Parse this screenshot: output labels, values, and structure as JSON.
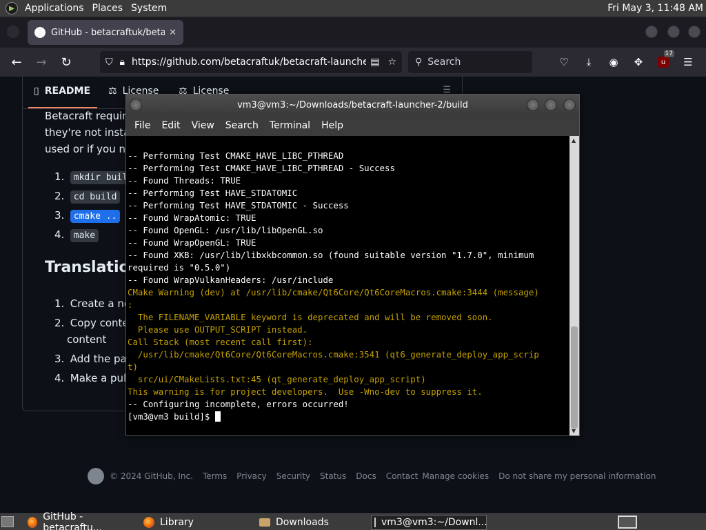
{
  "top_panel": {
    "menus": [
      "Applications",
      "Places",
      "System"
    ],
    "clock": "Fri May 3, 11:48 AM"
  },
  "browser": {
    "tab_title": "GitHub - betacraftuk/betacr",
    "tab_close": "✕",
    "url": "https://github.com/betacraftuk/betacraft-launcher",
    "search_placeholder": "Search",
    "ublock_badge": "17"
  },
  "readme": {
    "tabs": [
      "README",
      "License",
      "License"
    ],
    "lines": [
      "Betacraft require",
      "they're not instal",
      "used or if you ne"
    ],
    "steps": [
      {
        "num": "1.",
        "code": "mkdir buil"
      },
      {
        "num": "2.",
        "code": "cd build"
      },
      {
        "num": "3.",
        "code": "cmake .."
      },
      {
        "num": "4.",
        "code": "make"
      }
    ],
    "heading": "Translation",
    "translation_steps": [
      {
        "num": "1.",
        "text": "Create a ne"
      },
      {
        "num": "2.",
        "text": "Copy conte"
      },
      {
        "num": "",
        "text": "content"
      },
      {
        "num": "3.",
        "text": "Add the path"
      },
      {
        "num": "4.",
        "text": "Make a pull"
      }
    ]
  },
  "footer": {
    "items": [
      "© 2024 GitHub, Inc.",
      "Terms",
      "Privacy",
      "Security",
      "Status",
      "Docs",
      "Contact",
      "Manage cookies",
      "Do not share my personal information"
    ]
  },
  "terminal": {
    "title": "vm3@vm3:~/Downloads/betacraft-launcher-2/build",
    "menu": [
      "File",
      "Edit",
      "View",
      "Search",
      "Terminal",
      "Help"
    ],
    "lines": [
      {
        "c": "w",
        "t": "-- Performing Test CMAKE_HAVE_LIBC_PTHREAD"
      },
      {
        "c": "w",
        "t": "-- Performing Test CMAKE_HAVE_LIBC_PTHREAD - Success"
      },
      {
        "c": "w",
        "t": "-- Found Threads: TRUE"
      },
      {
        "c": "w",
        "t": "-- Performing Test HAVE_STDATOMIC"
      },
      {
        "c": "w",
        "t": "-- Performing Test HAVE_STDATOMIC - Success"
      },
      {
        "c": "w",
        "t": "-- Found WrapAtomic: TRUE"
      },
      {
        "c": "w",
        "t": "-- Found OpenGL: /usr/lib/libOpenGL.so"
      },
      {
        "c": "w",
        "t": "-- Found WrapOpenGL: TRUE"
      },
      {
        "c": "w",
        "t": "-- Found XKB: /usr/lib/libxkbcommon.so (found suitable version \"1.7.0\", minimum"
      },
      {
        "c": "w",
        "t": "required is \"0.5.0\")"
      },
      {
        "c": "w",
        "t": "-- Found WrapVulkanHeaders: /usr/include"
      },
      {
        "c": "y",
        "t": "CMake Warning (dev) at /usr/lib/cmake/Qt6Core/Qt6CoreMacros.cmake:3444 (message)"
      },
      {
        "c": "y",
        "t": ":"
      },
      {
        "c": "y",
        "t": "  The FILENAME_VARIABLE keyword is deprecated and will be removed soon."
      },
      {
        "c": "y",
        "t": "  Please use OUTPUT_SCRIPT instead."
      },
      {
        "c": "y",
        "t": "Call Stack (most recent call first):"
      },
      {
        "c": "y",
        "t": "  /usr/lib/cmake/Qt6Core/Qt6CoreMacros.cmake:3541 (qt6_generate_deploy_app_scrip"
      },
      {
        "c": "y",
        "t": "t)"
      },
      {
        "c": "y",
        "t": "  src/ui/CMakeLists.txt:45 (qt_generate_deploy_app_script)"
      },
      {
        "c": "y",
        "t": "This warning is for project developers.  Use -Wno-dev to suppress it."
      },
      {
        "c": "w",
        "t": ""
      },
      {
        "c": "w",
        "t": "-- Configuring incomplete, errors occurred!"
      }
    ],
    "prompt": "[vm3@vm3 build]$ "
  },
  "taskbar": {
    "items": [
      "GitHub - betacraftu...",
      "Library",
      "Downloads",
      "vm3@vm3:~/Downl..."
    ]
  }
}
